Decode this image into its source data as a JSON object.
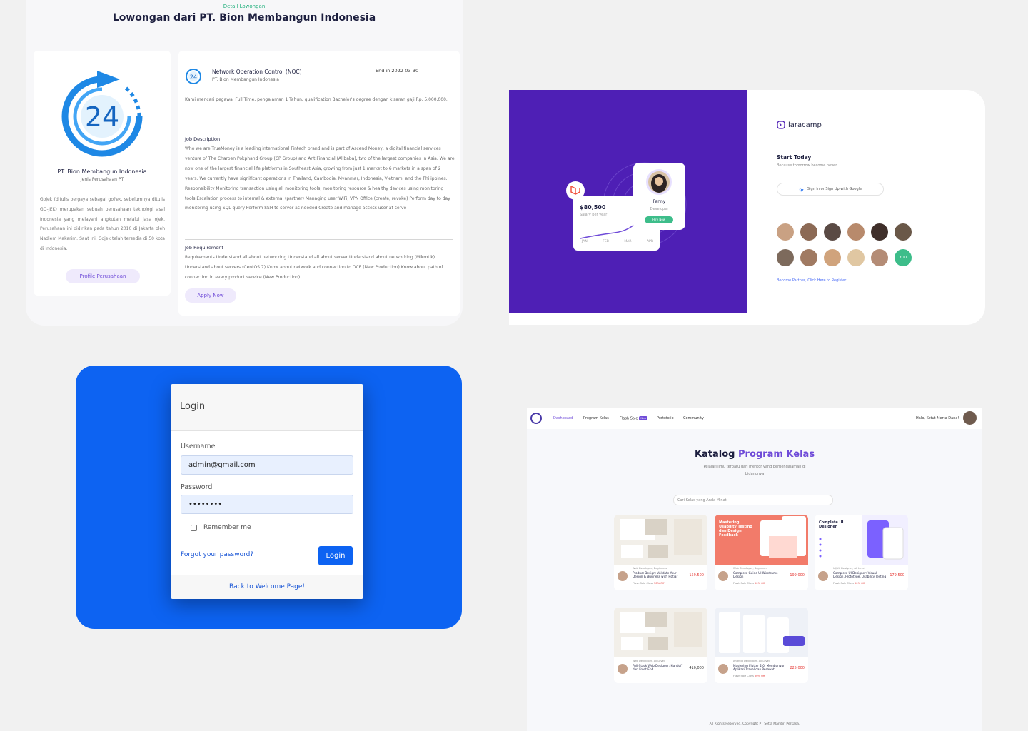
{
  "job_panel": {
    "kicker": "Detail Lowongan",
    "title": "Lowongan dari PT. Bion Membangun Indonesia",
    "company": {
      "logo_icon": "24-hour-refresh-icon",
      "name": "PT. Bion Membangun Indonesia",
      "type": "Jenis Perusahaan PT",
      "description": "Gojek (ditulis bergaya sebagai go?ek, sebelumnya ditulis GO-JEK) merupakan sebuah perusahaan teknologi asal Indonesia yang melayani angkutan melalui jasa ojek. Perusahaan ini didirikan pada tahun 2010 di Jakarta oleh Nadiem Makarim. Saat ini, Gojek telah tersedia di 50 kota di Indonesia.",
      "profile_button": "Profile Perusahaan"
    },
    "job": {
      "title": "Network Operation Control (NOC)",
      "company": "PT. Bion Membangun Indonesia",
      "end_date": "End in 2022-03-30",
      "summary": "Kami mencari pegawai Full Time, pengalaman 1 Tahun, qualification Bachelor's degree dengan kisaran gaji Rp. 5,000,000.",
      "description_heading": "Job Description",
      "description": "Who we are TrueMoney is a leading international Fintech brand and is part of Ascend Money, a digital financial services venture of The Charoen Pokphand Group (CP Group) and Ant Financial (Alibaba), two of the largest companies in Asia. We are now one of the largest financial life platforms in Southeast Asia, growing from just 1 market to 6 markets in a span of 2 years. We currently have significant operations in Thailand, Cambodia, Myanmar, Indonesia, Vietnam, and the Philippines. Responsibility Monitoring transaction using all monitoring tools, monitoring resource & healthy devices using monitoring tools Escalation process to internal & external (partner) Managing user WiFi, VPN Office (create, revoke) Perform day to day monitoring using SQL query Perform SSH to server as needed Create and manage access user at serve",
      "requirement_heading": "Job Requirement",
      "requirement": "Requirements Understand all about networking Understand all about server Understand about networking (Mikrotik) Understand about servers (CentOS 7) Know about network and connection to OCP (New Production) Know about path of connection in every product service (New Production)",
      "apply_button": "Apply Now"
    }
  },
  "laracamp_panel": {
    "brand": "laracamp",
    "salary_card": {
      "amount": "$80,500",
      "caption": "Salary per year",
      "months": [
        "JAN",
        "FEB",
        "MAR",
        "APR"
      ]
    },
    "profile_card": {
      "name": "Fanny",
      "role": "Developer",
      "button": "Hire Now"
    },
    "start_title": "Start Today",
    "start_sub": "Because tomorrow become never",
    "google_button": "Sign In or Sign Up with Google",
    "avatar_colors": [
      "#c9a183",
      "#8c6a55",
      "#5a4a44",
      "#b88a6c",
      "#3f2f2a",
      "#6a5848",
      "#7d6a5c",
      "#a07a62",
      "#d0a37c",
      "#e0c7a2",
      "#b48c76"
    ],
    "you_label": "YOU",
    "partner_link": "Become Partner, Click Here to Register",
    "colors": {
      "purple": "#4e1fb5",
      "green": "#3dbd8a"
    }
  },
  "login_panel": {
    "title": "Login",
    "username_label": "Username",
    "username_value": "admin@gmail.com",
    "password_label": "Password",
    "password_value": "••••••••",
    "remember_label": "Remember me",
    "forgot_link": "Forgot your password?",
    "login_button": "Login",
    "back_link": "Back to Welcome Page!",
    "colors": {
      "accent": "#0d63f2"
    }
  },
  "katalog_panel": {
    "nav": {
      "items": [
        "Dashboard",
        "Program Kelas",
        "Flash Sale",
        "Portofolio",
        "Community"
      ],
      "new_badge": "New",
      "greeting": "Halo, Ketut Merta Dana!"
    },
    "heading_plain": "Katalog",
    "heading_highlight": "Program Kelas",
    "subheading": "Pelajari ilmu terbaru dari mentor yang berpengalaman di bidangnya",
    "search_placeholder": "Cari Kelas yang Anda Minati",
    "courses": [
      {
        "meta": "Web Developer, Beginners",
        "title": "Product Design: Validate Your Design & Business with Hotjar",
        "price": "159.500",
        "flash": "Flash Sale Class",
        "off": "50% Off",
        "thumb": "photo",
        "flash_sale": true
      },
      {
        "meta": "Web Developer, Beginners",
        "title": "Complete Guide UI Wireframe Design",
        "price": "199.000",
        "flash": "Flash Sale Class",
        "off": "50% Off",
        "thumb": "salmon",
        "flash_sale": true,
        "thumb_text": "Mastering Usability Testing dan Design Feedback"
      },
      {
        "meta": "UI/UX Designer, All Level",
        "title": "Complete UI Designer: Visual Design, Prototype, Usability Testing",
        "price": "179.500",
        "flash": "Flash Sale Class",
        "off": "50% Off",
        "thumb": "ui",
        "flash_sale": true,
        "thumb_text": "Complete UI Designer"
      },
      {
        "meta": "Web Developer, All Level",
        "title": "Full-Stack Web Designer: Handoff dan Front-End",
        "price": "410,000",
        "flash": "",
        "off": "",
        "thumb": "photo",
        "flash_sale": false
      },
      {
        "meta": "Android Developer, All Level",
        "title": "Mastering Flutter 2.0: Membangun Aplikasi Travel dan Pesawat",
        "price": "225.000",
        "flash": "Flash Sale Class",
        "off": "50% Off",
        "thumb": "flutter",
        "flash_sale": true
      }
    ],
    "footer": "All Rights Reserved. Copyright PT Setia Mandiri Perkasa."
  }
}
